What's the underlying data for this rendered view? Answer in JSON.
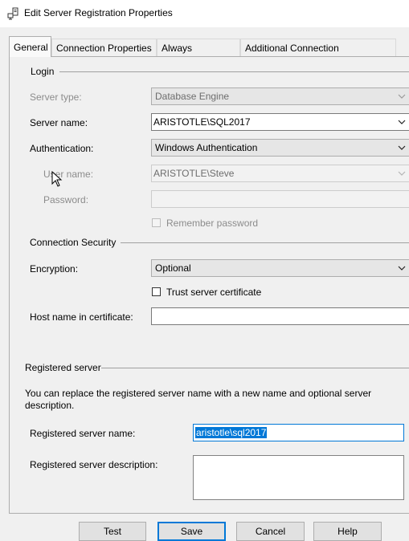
{
  "window": {
    "title": "Edit Server Registration Properties"
  },
  "tabs": [
    {
      "label": "General"
    },
    {
      "label": "Connection Properties"
    },
    {
      "label": "Always Encrypted"
    },
    {
      "label": "Additional Connection Parameters"
    }
  ],
  "login": {
    "group_label": "Login",
    "server_type_label": "Server type:",
    "server_type_value": "Database Engine",
    "server_name_label": "Server name:",
    "server_name_value": "ARISTOTLE\\SQL2017",
    "authentication_label": "Authentication:",
    "authentication_value": "Windows Authentication",
    "user_name_label": "User name:",
    "user_name_value": "ARISTOTLE\\Steve",
    "password_label": "Password:",
    "password_value": "",
    "remember_password_label": "Remember password"
  },
  "security": {
    "group_label": "Connection Security",
    "encryption_label": "Encryption:",
    "encryption_value": "Optional",
    "trust_cert_label": "Trust server certificate",
    "host_name_label": "Host name in certificate:",
    "host_name_value": ""
  },
  "registered": {
    "group_label": "Registered server",
    "description_text": "You can replace the registered server name with a new name and optional server description.",
    "name_label": "Registered server name:",
    "name_value": "aristotle\\sql2017",
    "description_label": "Registered server description:",
    "description_value": ""
  },
  "buttons": {
    "test": "Test",
    "save": "Save",
    "cancel": "Cancel",
    "help": "Help"
  },
  "colors": {
    "selection": "#0078d7",
    "disabled_text": "#8c8c8c"
  }
}
